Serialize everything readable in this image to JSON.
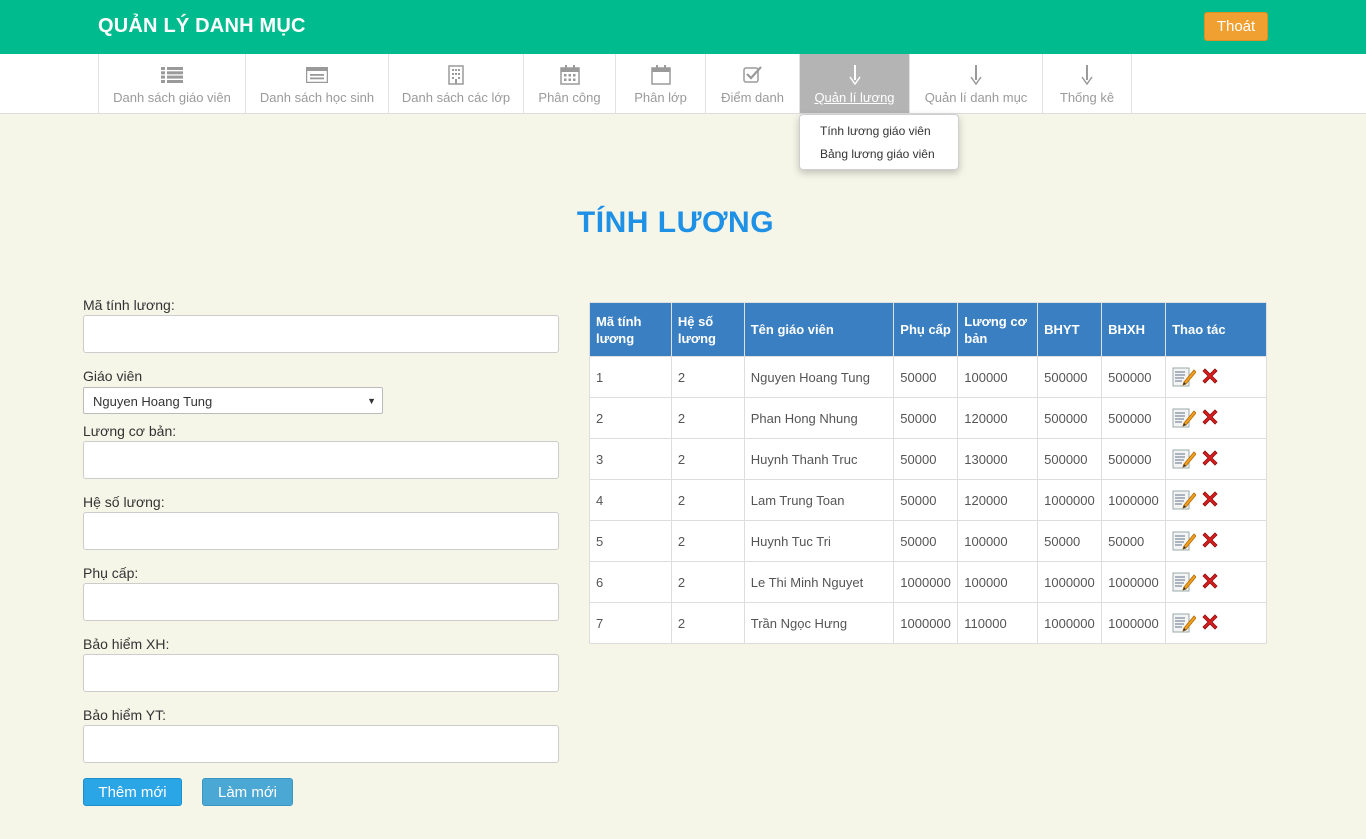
{
  "header": {
    "title": "QUẢN LÝ DANH MỤC",
    "logout_label": "Thoát"
  },
  "nav": {
    "items": [
      {
        "label": "Danh sách giáo viên",
        "icon": "list-icon"
      },
      {
        "label": "Danh sách học sinh",
        "icon": "card-icon"
      },
      {
        "label": "Danh sách các lớp",
        "icon": "building-icon"
      },
      {
        "label": "Phân công",
        "icon": "calendar-icon"
      },
      {
        "label": "Phân lớp",
        "icon": "calendar-blank-icon"
      },
      {
        "label": "Điểm danh",
        "icon": "checkbox-icon"
      },
      {
        "label": "Quản lí lương",
        "icon": "arrow-down-icon",
        "active": true
      },
      {
        "label": "Quản lí danh mục",
        "icon": "arrow-down-icon"
      },
      {
        "label": "Thống kê",
        "icon": "arrow-down-icon"
      }
    ],
    "dropdown": [
      "Tính lương giáo viên",
      "Bảng lương giáo viên"
    ]
  },
  "page_title": "TÍNH LƯƠNG",
  "form": {
    "ma_label": "Mã tính lương:",
    "giaovien_label": "Giáo viên",
    "giaovien_selected": "Nguyen Hoang Tung",
    "luong_label": "Lương cơ bản:",
    "heso_label": "Hệ số lương:",
    "phucap_label": "Phụ cấp:",
    "bhxh_label": "Bảo hiểm XH:",
    "bhyt_label": "Bảo hiểm YT:",
    "add_label": "Thêm mới",
    "reset_label": "Làm mới"
  },
  "table": {
    "headers": [
      "Mã tính lương",
      "Hệ số lương",
      "Tên giáo viên",
      "Phụ cấp",
      "Lương cơ bản",
      "BHYT",
      "BHXH",
      "Thao tác"
    ],
    "rows": [
      [
        "1",
        "2",
        "Nguyen Hoang Tung",
        "50000",
        "100000",
        "500000",
        "500000"
      ],
      [
        "2",
        "2",
        "Phan Hong Nhung",
        "50000",
        "120000",
        "500000",
        "500000"
      ],
      [
        "3",
        "2",
        "Huynh Thanh Truc",
        "50000",
        "130000",
        "500000",
        "500000"
      ],
      [
        "4",
        "2",
        "Lam Trung Toan",
        "50000",
        "120000",
        "1000000",
        "1000000"
      ],
      [
        "5",
        "2",
        "Huynh Tuc Tri",
        "50000",
        "100000",
        "50000",
        "50000"
      ],
      [
        "6",
        "2",
        "Le Thi Minh Nguyet",
        "1000000",
        "100000",
        "1000000",
        "1000000"
      ],
      [
        "7",
        "2",
        "Trần Ngọc Hưng",
        "1000000",
        "110000",
        "1000000",
        "1000000"
      ]
    ]
  },
  "colors": {
    "topbar": "#00bb8d",
    "accent_title": "#1e90e6",
    "table_header": "#3a7fc1",
    "logout": "#f0a030"
  }
}
